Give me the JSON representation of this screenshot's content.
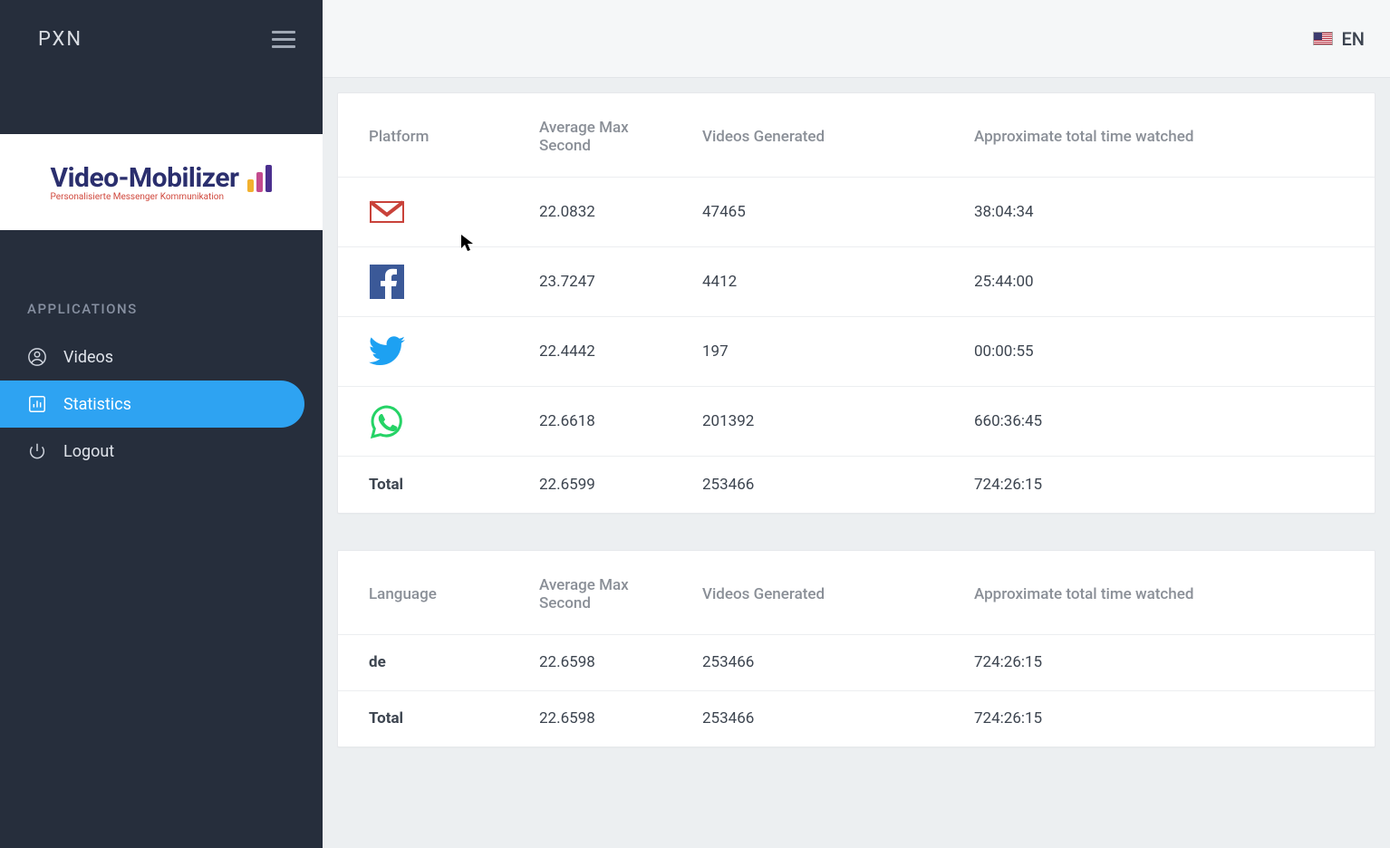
{
  "brand": "PXN",
  "logo": {
    "title": "Video-Mobilizer",
    "subtitle": "Personalisierte Messenger Kommunikation"
  },
  "sidebar": {
    "section_label": "APPLICATIONS",
    "items": [
      {
        "label": "Videos",
        "icon": "user-circle-icon"
      },
      {
        "label": "Statistics",
        "icon": "chart-icon",
        "active": true
      },
      {
        "label": "Logout",
        "icon": "power-icon"
      }
    ]
  },
  "topbar": {
    "language_label": "EN"
  },
  "tables": {
    "platform": {
      "headers": [
        "Platform",
        "Average Max Second",
        "Videos Generated",
        "Approximate total time watched"
      ],
      "rows": [
        {
          "icon": "gmail-icon",
          "avg": "22.0832",
          "videos": "47465",
          "time": "38:04:34"
        },
        {
          "icon": "facebook-icon",
          "avg": "23.7247",
          "videos": "4412",
          "time": "25:44:00"
        },
        {
          "icon": "twitter-icon",
          "avg": "22.4442",
          "videos": "197",
          "time": "00:00:55"
        },
        {
          "icon": "whatsapp-icon",
          "avg": "22.6618",
          "videos": "201392",
          "time": "660:36:45"
        }
      ],
      "total": {
        "label": "Total",
        "avg": "22.6599",
        "videos": "253466",
        "time": "724:26:15"
      }
    },
    "language": {
      "headers": [
        "Language",
        "Average Max Second",
        "Videos Generated",
        "Approximate total time watched"
      ],
      "rows": [
        {
          "lang": "de",
          "avg": "22.6598",
          "videos": "253466",
          "time": "724:26:15"
        }
      ],
      "total": {
        "label": "Total",
        "avg": "22.6598",
        "videos": "253466",
        "time": "724:26:15"
      }
    }
  }
}
